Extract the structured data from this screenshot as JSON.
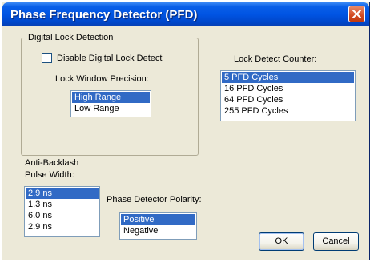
{
  "window": {
    "title": "Phase Frequency Detector (PFD)"
  },
  "digital_lock": {
    "group_label": "Digital Lock Detection",
    "checkbox_label": "Disable Digital Lock Detect",
    "checkbox_checked": false,
    "precision_label": "Lock Window Precision:",
    "precision_options": [
      "High Range",
      "Low Range"
    ],
    "precision_selected": "High Range"
  },
  "lock_counter": {
    "label": "Lock Detect Counter:",
    "options": [
      "5 PFD Cycles",
      "16 PFD Cycles",
      "64 PFD Cycles",
      "255 PFD Cycles"
    ],
    "selected": "5 PFD Cycles"
  },
  "anti_backlash": {
    "label_line1": "Anti-Backlash",
    "label_line2": "Pulse Width:",
    "options": [
      "2.9 ns",
      "1.3 ns",
      "6.0 ns",
      "2.9 ns"
    ],
    "selected_index": 0
  },
  "polarity": {
    "label": "Phase Detector Polarity:",
    "options": [
      "Positive",
      "Negative"
    ],
    "selected": "Positive"
  },
  "buttons": {
    "ok": "OK",
    "cancel": "Cancel"
  },
  "colors": {
    "titlebar": "#0054e3",
    "selection": "#316ac5",
    "dialog_bg": "#ece9d8",
    "close": "#d24a22"
  }
}
